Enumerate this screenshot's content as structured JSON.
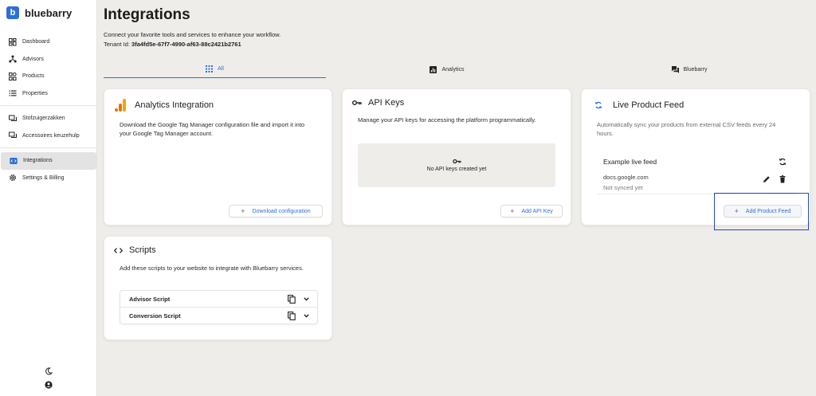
{
  "brand": {
    "logo_letter": "b",
    "name": "bluebarry",
    "color": "#2f6fd6"
  },
  "sidebar": {
    "items": [
      {
        "label": "Dashboard",
        "icon": "dashboard-icon"
      },
      {
        "label": "Advisors",
        "icon": "hierarchy-icon"
      },
      {
        "label": "Products",
        "icon": "grid-icon"
      },
      {
        "label": "Properties",
        "icon": "list-icon"
      },
      {
        "label": "Stofzuigerzakken",
        "icon": "chat-icon"
      },
      {
        "label": "Accessoires keuzehulp",
        "icon": "chat-icon"
      },
      {
        "label": "Integrations",
        "icon": "integrations-icon",
        "active": true
      },
      {
        "label": "Settings & Billing",
        "icon": "gear-icon"
      }
    ],
    "bottom_icons": [
      "moon-icon",
      "account-icon"
    ]
  },
  "header": {
    "title": "Integrations",
    "subtitle": "Connect your favorite tools and services to enhance your workflow.",
    "tenant_label": "Tenant Id:",
    "tenant_id": "3fa4fd5e-67f7-4990-af63-88c2421b2761"
  },
  "tabs": [
    {
      "label": "All",
      "icon": "apps-icon",
      "active": true
    },
    {
      "label": "Analytics",
      "icon": "analytics-icon"
    },
    {
      "label": "Bluebarry",
      "icon": "forum-icon"
    }
  ],
  "cards": {
    "analytics": {
      "title": "Analytics Integration",
      "description": "Download the Google Tag Manager configuration file and import it into your Google Tag Manager account.",
      "button": "Download configuration"
    },
    "api_keys": {
      "title": "API Keys",
      "description": "Manage your API keys for accessing the platform programmatically.",
      "empty": "No API keys created yet",
      "button": "Add API Key"
    },
    "live_feed": {
      "title": "Live Product Feed",
      "description": "Automatically sync your products from external CSV feeds every 24 hours.",
      "feed_name": "Example live feed",
      "feed_url": "docs.google.com",
      "feed_status": "Not synced yet",
      "button": "Add Product Feed"
    },
    "scripts": {
      "title": "Scripts",
      "description": "Add these scripts to your website to integrate with Bluebarry services.",
      "rows": [
        "Advisor Script",
        "Conversion Script"
      ]
    }
  },
  "colors": {
    "accent": "#2f6fd6",
    "highlight": "#2348c8",
    "background": "#efedea"
  }
}
